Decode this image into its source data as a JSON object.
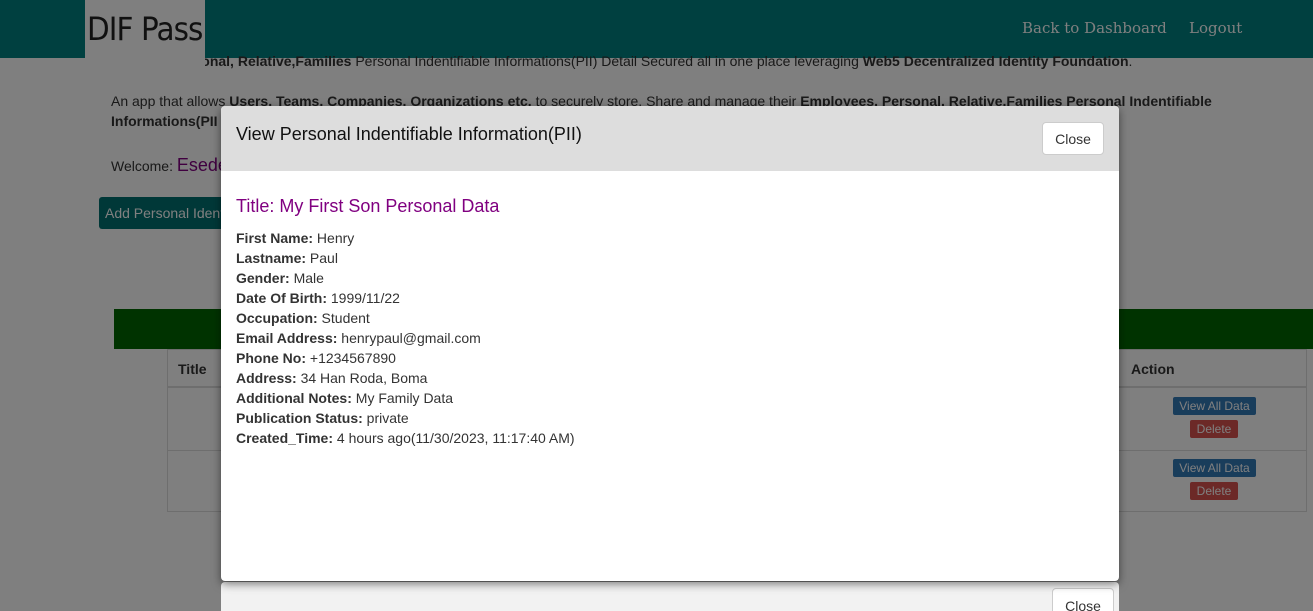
{
  "navbar": {
    "logo_text": "DIF Pass",
    "back_label": "Back to Dashboard",
    "logout_label": "Logout"
  },
  "background": {
    "intro_line1_bold_a": "ployees, Personal, Relative,Families",
    "intro_line1_text": " Personal Indentifiable Informations(PII) Detail Secured all in one place leveraging ",
    "intro_line1_bold_b": "Web5 Decentralized Identity Foundation",
    "intro_line1_end": ".",
    "intro_line2_a": "An app that allows ",
    "intro_line2_bold_a": "Users, Teams, Companies, Organizations etc.",
    "intro_line2_b": " to securely store, Share and manage their ",
    "intro_line2_bold_b": "Employees, Personal, Relative,Families Personal Indentifiable",
    "intro_line3_bold": "Informations(PII",
    "welcome_label": "Welcome: ",
    "welcome_name": "Esede",
    "add_button": "Add Personal Identi",
    "table": {
      "col_title": "Title",
      "col_action": "Action",
      "view_button": "View All Data",
      "delete_button": "Delete"
    }
  },
  "modal": {
    "header_title": "View Personal Indentifiable Information(PII)",
    "close_label": "Close",
    "pii_title": "Title: My First Son Personal Data",
    "fields": [
      {
        "label": "First Name:",
        "value": " Henry"
      },
      {
        "label": "Lastname:",
        "value": " Paul"
      },
      {
        "label": "Gender:",
        "value": " Male"
      },
      {
        "label": "Date Of Birth:",
        "value": " 1999/11/22"
      },
      {
        "label": "Occupation:",
        "value": " Student"
      },
      {
        "label": "Email Address:",
        "value": " henrypaul@gmail.com"
      },
      {
        "label": "Phone No:",
        "value": " +1234567890"
      },
      {
        "label": "Address:",
        "value": " 34 Han Roda, Boma"
      },
      {
        "label": "Additional Notes:",
        "value": " My Family Data"
      },
      {
        "label": "Publication Status:",
        "value": " private"
      },
      {
        "label": "Created_Time:",
        "value": " 4 hours ago(11/30/2023, 11:17:40 AM)"
      }
    ]
  },
  "modal_footer": {
    "close_label": "Close"
  },
  "colors": {
    "navbar": "#008080",
    "accent_purple": "#800080",
    "green_bar": "#006600",
    "view_button": "#337ab7",
    "delete_button": "#d9534f"
  }
}
